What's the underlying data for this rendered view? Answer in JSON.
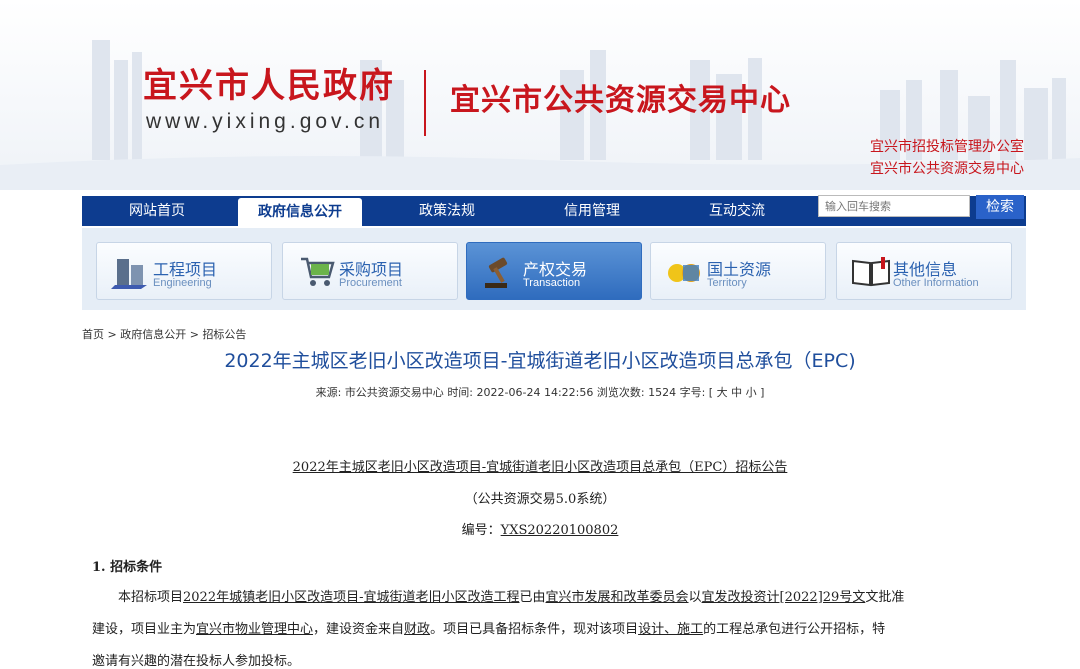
{
  "header": {
    "site_title": "宜兴市人民政府",
    "site_url": "www.yixing.gov.cn",
    "center_title": "宜兴市公共资源交易中心",
    "office_1": "宜兴市招投标管理办公室",
    "office_2": "宜兴市公共资源交易中心"
  },
  "nav": {
    "items": [
      "网站首页",
      "政府信息公开",
      "政策法规",
      "信用管理",
      "互动交流"
    ],
    "active_index": 1,
    "search_placeholder": "输入回车搜索",
    "search_button": "检索"
  },
  "categories": [
    {
      "name": "工程项目",
      "en": "Engineering",
      "icon": "building-icon"
    },
    {
      "name": "采购项目",
      "en": "Procurement",
      "icon": "shopping-cart-icon"
    },
    {
      "name": "产权交易",
      "en": "Transaction",
      "icon": "gavel-icon"
    },
    {
      "name": "国土资源",
      "en": "Territory",
      "icon": "land-coins-icon"
    },
    {
      "name": "其他信息",
      "en": "Other Information",
      "icon": "open-book-icon"
    }
  ],
  "breadcrumb": {
    "home": "首页",
    "sep": ">",
    "level1": "政府信息公开",
    "level2": "招标公告"
  },
  "article": {
    "title": "2022年主城区老旧小区改造项目-宜城街道老旧小区改造项目总承包（EPC)",
    "source_label": "来源:",
    "source": "市公共资源交易中心",
    "time_label": "时间:",
    "time": "2022-06-24 14:22:56",
    "views_label": "浏览次数:",
    "views": "1524",
    "font_label": "字号:",
    "font_large": "大",
    "font_medium": "中",
    "font_small": "小"
  },
  "notice": {
    "title_underlined": "2022年主城区老旧小区改造项目-宜城街道老旧小区改造项目总承包（EPC）",
    "title_suffix": "招标公告",
    "subtitle": "（公共资源交易5.0系统）",
    "code_label": "编号：",
    "code": "YXS20220100802",
    "section_1": "1. 招标条件",
    "p1_a": "本招标项目",
    "p1_project": "2022年城镇老旧小区改造项目-宜城街道老旧小区改造工程",
    "p1_b": "已由",
    "p1_approver": "宜兴市发展和改革委员会",
    "p1_c": "以",
    "p1_doc": "宜发改投资计[2022]29号文",
    "p1_d": "文批准",
    "p2_a": "建设，项目业主为",
    "p2_owner": "宜兴市物业管理中心",
    "p2_b": "，建设资金来自",
    "p2_funding": "财政",
    "p2_c": "。项目已具备招标条件，现对该项目",
    "p2_scope": "设计、施工",
    "p2_d": "的工程总承包进行公开招标，特",
    "p3": "邀请有兴趣的潜在投标人参加投标。"
  }
}
